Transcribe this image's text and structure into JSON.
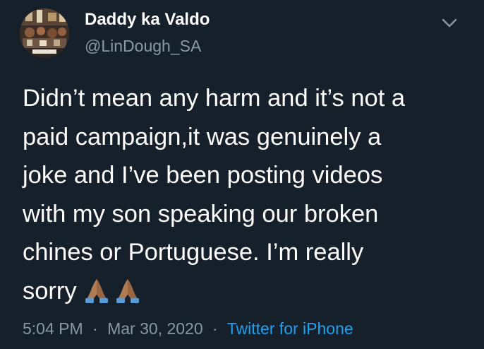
{
  "user": {
    "display_name": "Daddy ka Valdo",
    "handle": "@LinDough_SA"
  },
  "tweet": {
    "text": "Didn’t mean any harm and it’s not a\npaid campaign,it was genuinely a\njoke and I’ve been posting videos\nwith my son speaking our broken\nchines or Portuguese. I’m really\nsorry",
    "emoji_icons": [
      "folded-hands-icon",
      "folded-hands-icon"
    ]
  },
  "meta": {
    "time": "5:04 PM",
    "separator": "·",
    "date": "Mar 30, 2020",
    "source": "Twitter for iPhone"
  },
  "colors": {
    "background": "#15202b",
    "primary_text": "#ffffff",
    "secondary_text": "#8899a6",
    "link": "#1da1f2"
  }
}
